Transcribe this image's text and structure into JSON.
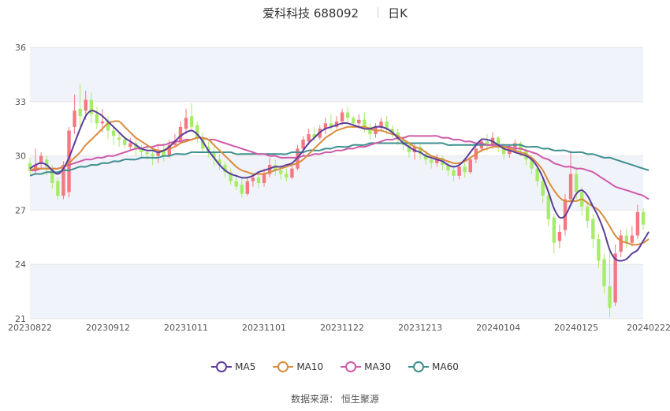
{
  "header": {
    "stock_name": "爱科科技 688092",
    "period": "日K"
  },
  "source_text": "数据来源： 恒生聚源",
  "colors": {
    "up": "#f4787f",
    "down": "#a6ec68",
    "ma5": "#5b3d9a",
    "ma10": "#d98c3c",
    "ma30": "#cf5aa8",
    "ma60": "#3f8f8f",
    "band": "#f1f3fa",
    "grid": "#e6e6e6"
  },
  "chart_data": {
    "type": "candlestick",
    "title": "爱科科技 688092",
    "ylim": [
      21,
      36
    ],
    "yticks": [
      21,
      24,
      27,
      30,
      33,
      36
    ],
    "x_tick_labels": [
      "20230822",
      "20230912",
      "20231011",
      "20231101",
      "20231122",
      "20231213",
      "20240104",
      "20240125",
      "20240222"
    ],
    "x_tick_index": [
      0,
      14,
      28,
      42,
      56,
      70,
      84,
      98,
      111
    ],
    "legend": [
      "MA5",
      "MA10",
      "MA30",
      "MA60"
    ],
    "candles": [
      [
        29.6,
        29.2,
        29.9,
        29.0
      ],
      [
        29.2,
        29.5,
        30.4,
        29.0
      ],
      [
        29.6,
        30.0,
        30.2,
        29.3
      ],
      [
        29.8,
        29.4,
        30.0,
        28.9
      ],
      [
        29.3,
        28.5,
        29.5,
        28.2
      ],
      [
        28.6,
        27.8,
        28.8,
        27.6
      ],
      [
        27.8,
        29.5,
        29.7,
        27.6
      ],
      [
        28.0,
        31.4,
        31.6,
        27.7
      ],
      [
        31.6,
        32.5,
        33.4,
        31.2
      ],
      [
        32.6,
        32.2,
        34.0,
        31.6
      ],
      [
        32.5,
        33.1,
        33.6,
        32.0
      ],
      [
        33.1,
        32.3,
        33.5,
        31.8
      ],
      [
        32.3,
        31.8,
        32.7,
        31.5
      ],
      [
        31.8,
        31.9,
        32.6,
        31.3
      ],
      [
        31.9,
        31.4,
        32.2,
        30.9
      ],
      [
        31.4,
        31.1,
        31.6,
        30.6
      ],
      [
        31.0,
        30.9,
        31.3,
        30.5
      ],
      [
        30.9,
        30.6,
        31.1,
        30.4
      ],
      [
        30.5,
        30.7,
        31.0,
        30.3
      ],
      [
        30.7,
        30.4,
        30.9,
        30.0
      ],
      [
        30.4,
        30.2,
        30.6,
        29.9
      ],
      [
        30.2,
        30.1,
        30.5,
        29.8
      ],
      [
        30.1,
        30.0,
        30.4,
        29.5
      ],
      [
        30.0,
        30.2,
        30.6,
        29.6
      ],
      [
        30.3,
        30.0,
        30.7,
        29.7
      ],
      [
        30.0,
        30.6,
        30.9,
        29.9
      ],
      [
        30.6,
        30.8,
        31.2,
        30.5
      ],
      [
        30.8,
        31.6,
        31.9,
        30.7
      ],
      [
        31.5,
        32.1,
        32.6,
        31.2
      ],
      [
        32.2,
        31.6,
        32.9,
        31.4
      ],
      [
        31.7,
        31.0,
        31.9,
        30.7
      ],
      [
        31.0,
        30.4,
        31.3,
        30.2
      ],
      [
        30.5,
        30.2,
        30.8,
        29.9
      ],
      [
        30.2,
        29.9,
        30.5,
        29.4
      ],
      [
        29.8,
        29.5,
        30.1,
        29.2
      ],
      [
        29.5,
        29.1,
        29.7,
        28.8
      ],
      [
        29.1,
        28.6,
        29.3,
        28.4
      ],
      [
        28.6,
        28.3,
        28.9,
        28.1
      ],
      [
        28.4,
        27.9,
        28.8,
        27.7
      ],
      [
        27.9,
        28.6,
        28.8,
        27.8
      ],
      [
        28.6,
        28.8,
        29.0,
        28.3
      ],
      [
        28.8,
        28.5,
        29.1,
        28.2
      ],
      [
        28.5,
        29.0,
        29.3,
        28.3
      ],
      [
        29.0,
        29.5,
        29.9,
        28.8
      ],
      [
        29.5,
        29.2,
        29.8,
        28.9
      ],
      [
        29.2,
        29.0,
        29.5,
        28.7
      ],
      [
        29.0,
        28.8,
        29.3,
        28.6
      ],
      [
        28.8,
        29.3,
        29.6,
        28.7
      ],
      [
        29.3,
        30.4,
        30.6,
        29.2
      ],
      [
        30.4,
        30.9,
        31.1,
        30.0
      ],
      [
        30.8,
        31.2,
        31.5,
        30.6
      ],
      [
        31.2,
        31.0,
        31.6,
        30.8
      ],
      [
        31.0,
        31.5,
        31.7,
        30.9
      ],
      [
        31.5,
        31.8,
        32.1,
        31.2
      ],
      [
        31.8,
        31.6,
        32.3,
        31.4
      ],
      [
        31.6,
        31.9,
        32.2,
        31.5
      ],
      [
        31.9,
        32.4,
        32.6,
        31.7
      ],
      [
        32.4,
        32.1,
        32.7,
        31.8
      ],
      [
        32.1,
        31.8,
        32.2,
        31.6
      ],
      [
        31.8,
        32.0,
        32.3,
        31.5
      ],
      [
        32.0,
        31.6,
        32.4,
        31.3
      ],
      [
        31.6,
        31.2,
        31.8,
        30.9
      ],
      [
        31.2,
        31.6,
        31.8,
        31.0
      ],
      [
        31.6,
        31.9,
        32.1,
        31.4
      ],
      [
        31.9,
        31.5,
        32.2,
        31.2
      ],
      [
        31.5,
        31.3,
        31.7,
        31.0
      ],
      [
        31.3,
        30.9,
        31.5,
        30.6
      ],
      [
        30.9,
        30.6,
        31.1,
        30.3
      ],
      [
        30.6,
        30.2,
        30.8,
        29.9
      ],
      [
        30.2,
        30.5,
        30.7,
        29.8
      ],
      [
        30.5,
        30.1,
        30.7,
        29.8
      ],
      [
        30.1,
        29.8,
        30.3,
        29.5
      ],
      [
        29.8,
        29.6,
        30.0,
        29.3
      ],
      [
        29.6,
        29.9,
        30.1,
        29.4
      ],
      [
        29.9,
        29.5,
        30.0,
        29.2
      ],
      [
        29.5,
        29.2,
        29.7,
        28.9
      ],
      [
        29.2,
        28.9,
        29.4,
        28.6
      ],
      [
        28.9,
        29.4,
        29.6,
        28.7
      ],
      [
        29.4,
        29.1,
        29.6,
        28.8
      ],
      [
        29.1,
        29.8,
        29.9,
        29.0
      ],
      [
        29.8,
        30.4,
        30.6,
        29.6
      ],
      [
        30.4,
        30.8,
        31.0,
        30.2
      ],
      [
        30.8,
        30.6,
        31.2,
        30.3
      ],
      [
        30.6,
        31.0,
        31.3,
        30.4
      ],
      [
        31.0,
        30.5,
        31.1,
        30.2
      ],
      [
        30.5,
        30.1,
        30.7,
        29.8
      ],
      [
        30.1,
        30.4,
        30.6,
        29.9
      ],
      [
        30.4,
        30.7,
        30.9,
        30.2
      ],
      [
        30.7,
        30.3,
        30.8,
        30.0
      ],
      [
        30.3,
        29.8,
        30.4,
        29.5
      ],
      [
        29.8,
        29.3,
        30.0,
        29.0
      ],
      [
        29.3,
        28.6,
        29.4,
        28.3
      ],
      [
        28.6,
        27.8,
        28.8,
        27.4
      ],
      [
        27.8,
        26.5,
        28.0,
        26.1
      ],
      [
        26.6,
        25.2,
        26.8,
        24.6
      ],
      [
        25.3,
        25.8,
        26.2,
        24.9
      ],
      [
        25.9,
        27.6,
        27.9,
        25.6
      ],
      [
        27.6,
        29.0,
        30.3,
        27.4
      ],
      [
        29.0,
        28.0,
        29.4,
        27.6
      ],
      [
        28.0,
        27.2,
        28.3,
        26.7
      ],
      [
        27.2,
        26.4,
        27.5,
        26.0
      ],
      [
        26.5,
        25.4,
        26.8,
        24.9
      ],
      [
        25.4,
        24.2,
        25.7,
        23.8
      ],
      [
        24.3,
        22.8,
        24.6,
        22.4
      ],
      [
        22.8,
        21.6,
        24.9,
        21.1
      ],
      [
        21.9,
        24.6,
        25.1,
        21.7
      ],
      [
        24.7,
        25.6,
        25.9,
        24.4
      ],
      [
        25.6,
        25.2,
        26.0,
        24.9
      ],
      [
        25.2,
        25.6,
        26.1,
        25.0
      ],
      [
        25.6,
        26.9,
        27.3,
        25.4
      ],
      [
        26.9,
        26.2,
        27.1,
        25.9
      ]
    ],
    "ma5": [
      29.3,
      29.5,
      29.6,
      29.5,
      29.2,
      29.0,
      29.3,
      29.9,
      30.7,
      31.5,
      32.2,
      32.5,
      32.4,
      32.2,
      31.9,
      31.6,
      31.3,
      31.0,
      30.8,
      30.6,
      30.4,
      30.3,
      30.3,
      30.2,
      30.3,
      30.5,
      30.8,
      31.1,
      31.3,
      31.4,
      31.2,
      30.8,
      30.3,
      29.9,
      29.5,
      29.2,
      29.0,
      28.9,
      28.8,
      28.8,
      28.9,
      29.1,
      29.2,
      29.3,
      29.4,
      29.4,
      29.5,
      29.6,
      29.9,
      30.3,
      30.7,
      31.0,
      31.3,
      31.5,
      31.6,
      31.7,
      31.8,
      31.8,
      31.7,
      31.6,
      31.5,
      31.5,
      31.6,
      31.6,
      31.5,
      31.3,
      31.0,
      30.7,
      30.5,
      30.3,
      30.2,
      30.0,
      29.9,
      29.8,
      29.7,
      29.5,
      29.4,
      29.5,
      29.8,
      30.2,
      30.6,
      30.9,
      30.9,
      30.8,
      30.6,
      30.4,
      30.3,
      30.2,
      30.1,
      30.0,
      29.8,
      29.4,
      28.8,
      28.0,
      27.1,
      26.6,
      26.7,
      27.3,
      27.9,
      28.1,
      27.8,
      27.2,
      26.6,
      25.8,
      24.8,
      24.3,
      24.2,
      24.3,
      24.6,
      24.8,
      25.3,
      25.8
    ],
    "ma10": [
      29.2,
      29.3,
      29.3,
      29.3,
      29.3,
      29.3,
      29.4,
      29.6,
      29.9,
      30.2,
      30.6,
      30.9,
      31.2,
      31.5,
      31.8,
      31.9,
      31.9,
      31.6,
      31.3,
      31.0,
      30.8,
      30.6,
      30.4,
      30.3,
      30.3,
      30.4,
      30.5,
      30.7,
      30.8,
      30.9,
      31.0,
      31.0,
      30.9,
      30.6,
      30.3,
      30.0,
      29.7,
      29.4,
      29.2,
      29.1,
      29.0,
      29.0,
      29.0,
      29.1,
      29.2,
      29.3,
      29.4,
      29.5,
      29.6,
      29.8,
      30.1,
      30.4,
      30.7,
      31.0,
      31.2,
      31.4,
      31.5,
      31.6,
      31.6,
      31.6,
      31.6,
      31.5,
      31.4,
      31.4,
      31.3,
      31.2,
      31.1,
      30.9,
      30.7,
      30.5,
      30.4,
      30.2,
      30.0,
      29.9,
      29.8,
      29.7,
      29.6,
      29.6,
      29.7,
      29.9,
      30.1,
      30.3,
      30.4,
      30.5,
      30.5,
      30.5,
      30.4,
      30.3,
      30.2,
      30.1,
      29.9,
      29.6,
      29.2,
      28.6,
      28.1,
      27.7,
      27.5,
      27.5,
      27.5,
      27.6,
      27.4,
      27.2,
      27.0,
      26.6,
      26.1,
      25.6,
      25.3,
      25.2,
      25.1,
      25.1,
      25.2,
      25.4
    ],
    "ma30": [
      29.2,
      29.2,
      29.3,
      29.3,
      29.3,
      29.3,
      29.4,
      29.5,
      29.6,
      29.7,
      29.8,
      29.8,
      29.9,
      29.9,
      30.0,
      30.0,
      30.1,
      30.2,
      30.3,
      30.4,
      30.4,
      30.5,
      30.5,
      30.6,
      30.6,
      30.7,
      30.8,
      30.8,
      30.9,
      30.9,
      31.0,
      31.0,
      30.9,
      30.9,
      30.8,
      30.7,
      30.6,
      30.5,
      30.4,
      30.3,
      30.2,
      30.1,
      30.1,
      30.0,
      30.0,
      29.9,
      29.9,
      29.9,
      29.9,
      30.0,
      30.0,
      30.1,
      30.1,
      30.2,
      30.2,
      30.3,
      30.3,
      30.4,
      30.4,
      30.5,
      30.5,
      30.6,
      30.7,
      30.8,
      30.9,
      30.9,
      31.0,
      31.0,
      31.1,
      31.1,
      31.1,
      31.1,
      31.1,
      31.1,
      31.0,
      31.0,
      30.9,
      30.9,
      30.8,
      30.8,
      30.7,
      30.7,
      30.6,
      30.6,
      30.6,
      30.5,
      30.5,
      30.4,
      30.4,
      30.3,
      30.2,
      30.1,
      29.9,
      29.8,
      29.6,
      29.5,
      29.4,
      29.4,
      29.3,
      29.3,
      29.2,
      29.1,
      28.9,
      28.7,
      28.5,
      28.3,
      28.2,
      28.1,
      28.0,
      27.9,
      27.8,
      27.6
    ],
    "ma60": [
      28.9,
      29.0,
      29.0,
      29.1,
      29.1,
      29.1,
      29.2,
      29.2,
      29.3,
      29.4,
      29.4,
      29.5,
      29.5,
      29.6,
      29.6,
      29.7,
      29.7,
      29.8,
      29.8,
      29.8,
      29.9,
      29.9,
      29.9,
      29.9,
      30.0,
      30.0,
      30.1,
      30.1,
      30.1,
      30.2,
      30.2,
      30.2,
      30.2,
      30.2,
      30.2,
      30.2,
      30.2,
      30.1,
      30.1,
      30.1,
      30.1,
      30.1,
      30.1,
      30.1,
      30.1,
      30.1,
      30.1,
      30.2,
      30.2,
      30.2,
      30.3,
      30.3,
      30.3,
      30.4,
      30.4,
      30.5,
      30.5,
      30.5,
      30.6,
      30.6,
      30.6,
      30.7,
      30.7,
      30.7,
      30.7,
      30.7,
      30.7,
      30.7,
      30.7,
      30.7,
      30.7,
      30.7,
      30.7,
      30.7,
      30.7,
      30.6,
      30.6,
      30.6,
      30.6,
      30.6,
      30.6,
      30.6,
      30.6,
      30.6,
      30.6,
      30.6,
      30.6,
      30.6,
      30.6,
      30.5,
      30.5,
      30.5,
      30.4,
      30.4,
      30.3,
      30.3,
      30.3,
      30.2,
      30.2,
      30.2,
      30.1,
      30.1,
      30.0,
      29.9,
      29.9,
      29.8,
      29.7,
      29.6,
      29.5,
      29.4,
      29.3,
      29.2
    ]
  }
}
